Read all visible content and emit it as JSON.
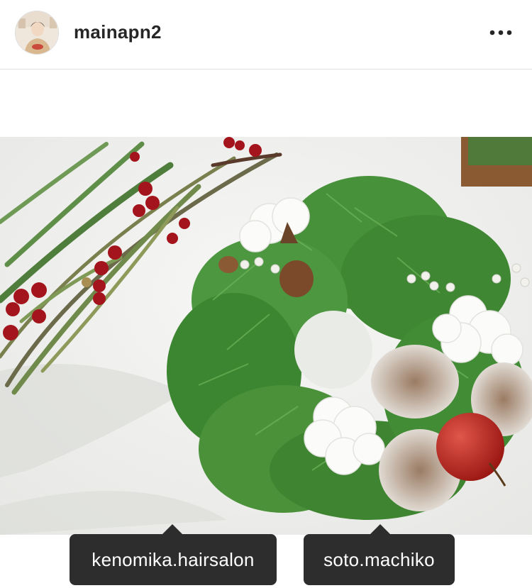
{
  "post": {
    "username": "mainapn2",
    "more_icon": "more-horizontal-icon",
    "avatar": "profile-avatar"
  },
  "photo": {
    "subject": "christmas-wreath-photo"
  },
  "tags": [
    {
      "label": "kenomika.hairsalon"
    },
    {
      "label": "soto.machiko"
    }
  ],
  "colors": {
    "tag_background": "#2d2d2d",
    "tag_text": "#ffffff",
    "username": "#262626"
  }
}
